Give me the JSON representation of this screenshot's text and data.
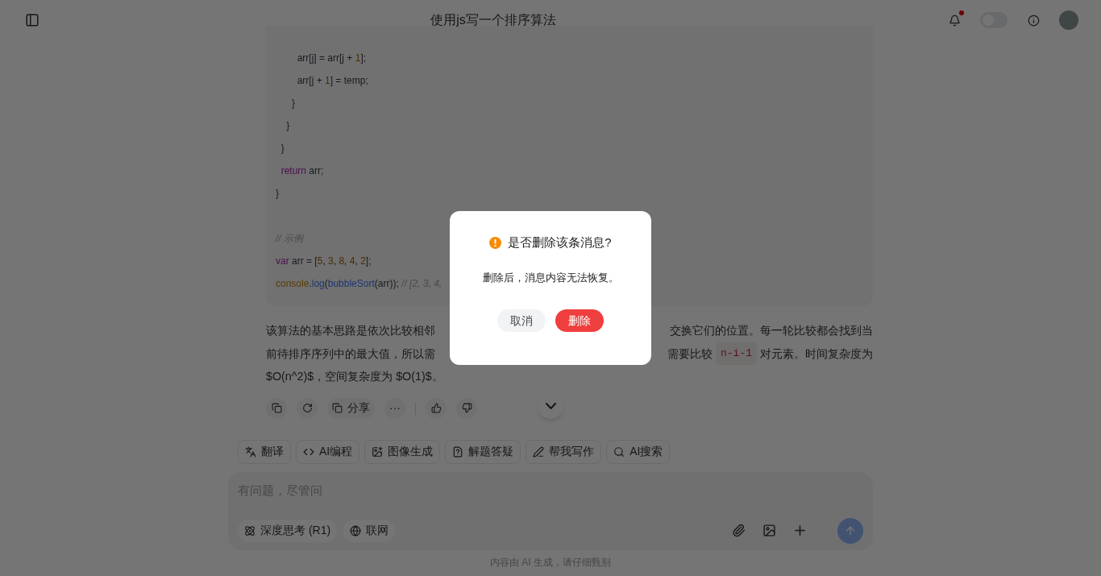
{
  "header": {
    "title": "使用js写一个排序算法",
    "notification_dot": true,
    "theme_switch": {
      "on": false
    }
  },
  "code_groups": [
    [
      [
        {
          "kind": "plain",
          "text": "        arr[j] = arr[j + "
        },
        {
          "kind": "number",
          "text": "1"
        },
        {
          "kind": "plain",
          "text": "];"
        }
      ],
      [
        {
          "kind": "plain",
          "text": "        arr[j + "
        },
        {
          "kind": "number",
          "text": "1"
        },
        {
          "kind": "plain",
          "text": "] = temp;"
        }
      ],
      [
        {
          "kind": "plain",
          "text": "      }"
        }
      ],
      [
        {
          "kind": "plain",
          "text": "    }"
        }
      ],
      [
        {
          "kind": "plain",
          "text": "  }"
        }
      ],
      [
        {
          "kind": "keyword",
          "text": "  return"
        },
        {
          "kind": "plain",
          "text": " arr;"
        }
      ],
      [
        {
          "kind": "plain",
          "text": "}"
        }
      ]
    ],
    [
      [
        {
          "kind": "comment",
          "text": "// 示例"
        }
      ],
      [
        {
          "kind": "keyword",
          "text": "var"
        },
        {
          "kind": "plain",
          "text": " arr = ["
        },
        {
          "kind": "number",
          "text": "5"
        },
        {
          "kind": "plain",
          "text": ", "
        },
        {
          "kind": "number",
          "text": "3"
        },
        {
          "kind": "plain",
          "text": ", "
        },
        {
          "kind": "number",
          "text": "8"
        },
        {
          "kind": "plain",
          "text": ", "
        },
        {
          "kind": "number",
          "text": "4"
        },
        {
          "kind": "plain",
          "text": ", "
        },
        {
          "kind": "number",
          "text": "2"
        },
        {
          "kind": "plain",
          "text": "];"
        }
      ],
      [
        {
          "kind": "object",
          "text": "console"
        },
        {
          "kind": "plain",
          "text": "."
        },
        {
          "kind": "func",
          "text": "log"
        },
        {
          "kind": "plain",
          "text": "("
        },
        {
          "kind": "func",
          "text": "bubbleSort"
        },
        {
          "kind": "plain",
          "text": "(arr)); "
        },
        {
          "kind": "comment",
          "text": "// [2, 3, 4,"
        }
      ]
    ]
  ],
  "paragraph_lines": [
    {
      "left": [
        {
          "kind": "text",
          "text": "该算法的基本思路是依次比较相邻"
        }
      ],
      "right": [
        {
          "kind": "text",
          "text": "交换它们的位置。每一轮比较都会找到当"
        }
      ]
    },
    {
      "left": [
        {
          "kind": "text",
          "text": "前待排序序列中的最大值，所以需"
        }
      ],
      "right": [
        {
          "kind": "text",
          "text": "需要比较"
        },
        {
          "kind": "code",
          "text": "n-i-1"
        },
        {
          "kind": "text",
          "text": "对元素。时间复杂度为"
        }
      ]
    },
    {
      "left": [
        {
          "kind": "text",
          "text": "$O(n^2)$，空间复杂度为 $O(1)$。"
        }
      ]
    }
  ],
  "message_actions": [
    {
      "kind": "copy"
    },
    {
      "kind": "regenerate"
    },
    {
      "kind": "share",
      "label": "分享"
    },
    {
      "kind": "more",
      "label": "···"
    },
    {
      "kind": "divider"
    },
    {
      "kind": "like"
    },
    {
      "kind": "dislike"
    }
  ],
  "tools": [
    {
      "kind": "translate",
      "label": "翻译"
    },
    {
      "kind": "code",
      "label": "AI编程"
    },
    {
      "kind": "image",
      "label": "图像生成"
    },
    {
      "kind": "solve",
      "label": "解题答疑"
    },
    {
      "kind": "write",
      "label": "帮我写作"
    },
    {
      "kind": "search",
      "label": "AI搜索"
    }
  ],
  "composer": {
    "placeholder": "有问题，尽管问",
    "options": [
      {
        "kind": "think",
        "label": "深度思考 (R1)"
      },
      {
        "kind": "web",
        "label": "联网"
      }
    ],
    "send_disabled": true
  },
  "footer": "内容由 AI 生成，请仔细甄别",
  "dialog": {
    "title": "是否删除该条消息?",
    "message": "删除后，消息内容无法恢复。",
    "cancel": "取消",
    "confirm": "删除"
  }
}
